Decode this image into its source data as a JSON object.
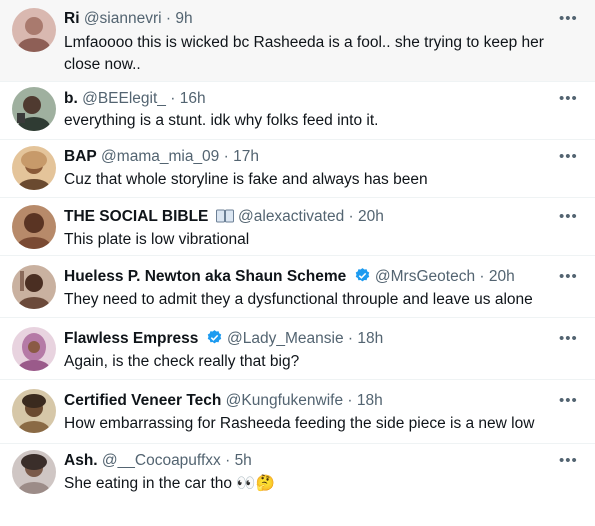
{
  "tweets": [
    {
      "name": "Ri",
      "handle": "@siannevri",
      "time": "9h",
      "text": "Lmfaoooo this is wicked bc Rasheeda is a fool.. she trying to keep her close now..",
      "avatar_color": "#d9b8b0",
      "verified": false
    },
    {
      "name": "b.",
      "handle": "@BEElegit_",
      "time": "16h",
      "text": "everything is a stunt. idk why folks feed into it.",
      "avatar_color": "#6f8a6f",
      "verified": false
    },
    {
      "name": "BAP",
      "handle": "@mama_mia_09",
      "time": "17h",
      "text": "Cuz that whole storyline is fake and always has been",
      "avatar_color": "#c79a6a",
      "verified": false
    },
    {
      "name": "THE SOCIAL BIBLE",
      "handle": "@alexactivated",
      "time": "20h",
      "text": "This plate is low vibrational",
      "avatar_color": "#7a4a33",
      "verified": false,
      "name_icon": "book-icon"
    },
    {
      "name": "Hueless P. Newton aka Shaun Scheme",
      "handle": "@MrsGeotech",
      "time": "20h",
      "text": "They need to admit they a dysfunctional throuple and leave us alone",
      "avatar_color": "#6b4a3a",
      "verified": true
    },
    {
      "name": "Flawless Empress",
      "handle": "@Lady_Meansie",
      "time": "18h",
      "text": "Again, is the check really that big?",
      "avatar_color": "#b57aa6",
      "verified": true
    },
    {
      "name": "Certified Veneer Tech",
      "handle": "@Kungfukenwife",
      "time": "18h",
      "text": "How embarrassing for Rasheeda feeding the side piece is a new low",
      "avatar_color": "#8a6a45",
      "verified": false
    },
    {
      "name": "Ash.",
      "handle": "@__Cocoapuffxx",
      "time": "5h",
      "text": "She eating in the car tho 👀🤔",
      "avatar_color": "#9c8c88",
      "verified": false
    }
  ],
  "ui": {
    "separator": "·",
    "more_glyph": "•••",
    "accent_verified": "#1d9bf0"
  }
}
